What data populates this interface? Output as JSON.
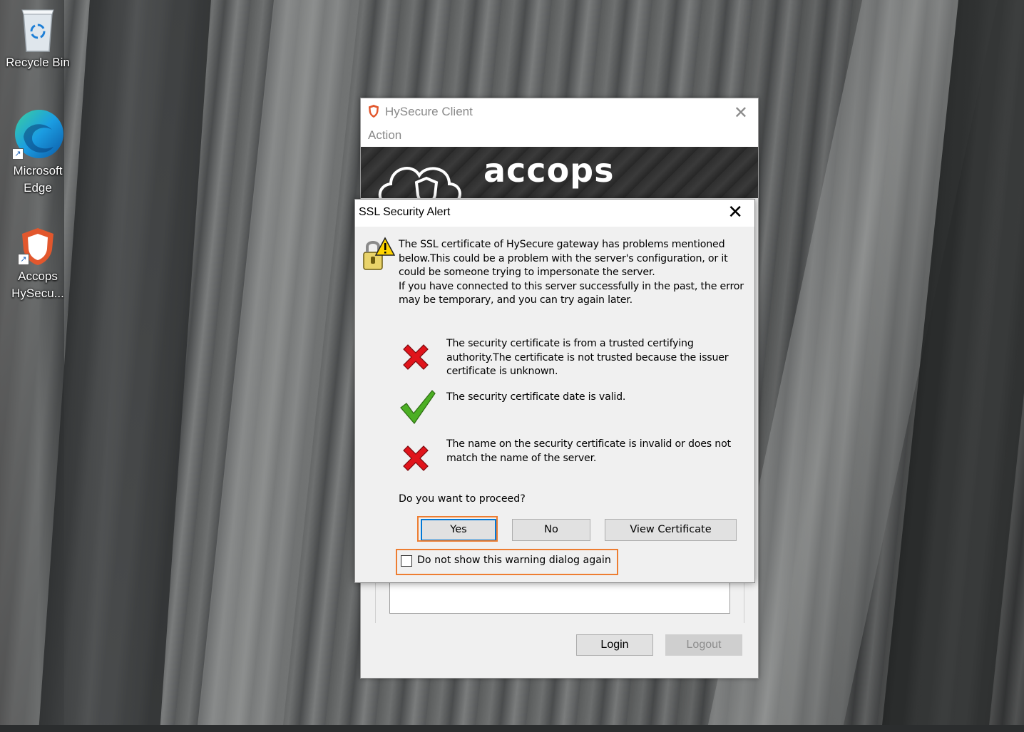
{
  "desktop": {
    "icons": [
      {
        "label": "Recycle Bin"
      },
      {
        "label": "Microsoft Edge"
      },
      {
        "label": "Accops HySecu..."
      }
    ]
  },
  "hysecure_window": {
    "title": "HySecure Client",
    "menu": {
      "action": "Action"
    },
    "banner": {
      "brand": "accops"
    },
    "buttons": {
      "login": "Login",
      "logout": "Logout"
    },
    "colors": {
      "accent": "#e2572d"
    }
  },
  "ssl_dialog": {
    "title": "SSL Security Alert",
    "intro": "The SSL certificate of HySecure gateway has problems mentioned below.This could be a problem with the server's configuration, or it could be someone trying to impersonate the server.\nIf you have connected to this server successfully in the past, the error may be temporary, and you can try again later.",
    "checks": [
      {
        "status": "fail",
        "icon": "red-x-icon",
        "text": "The security certificate is from a trusted certifying authority.The certificate is not trusted because the issuer certificate is unknown."
      },
      {
        "status": "pass",
        "icon": "green-check-icon",
        "text": "The security certificate date is valid."
      },
      {
        "status": "fail",
        "icon": "red-x-icon",
        "text": "The name on the security certificate is invalid or does not match the name of the server."
      }
    ],
    "question": "Do you want to proceed?",
    "buttons": {
      "yes": "Yes",
      "no": "No",
      "view_certificate": "View Certificate"
    },
    "checkbox": {
      "label": "Do not show this warning dialog again",
      "checked": false
    },
    "colors": {
      "highlight": "#ed7d31",
      "fail": "#e0141b",
      "pass": "#4caf24"
    }
  }
}
